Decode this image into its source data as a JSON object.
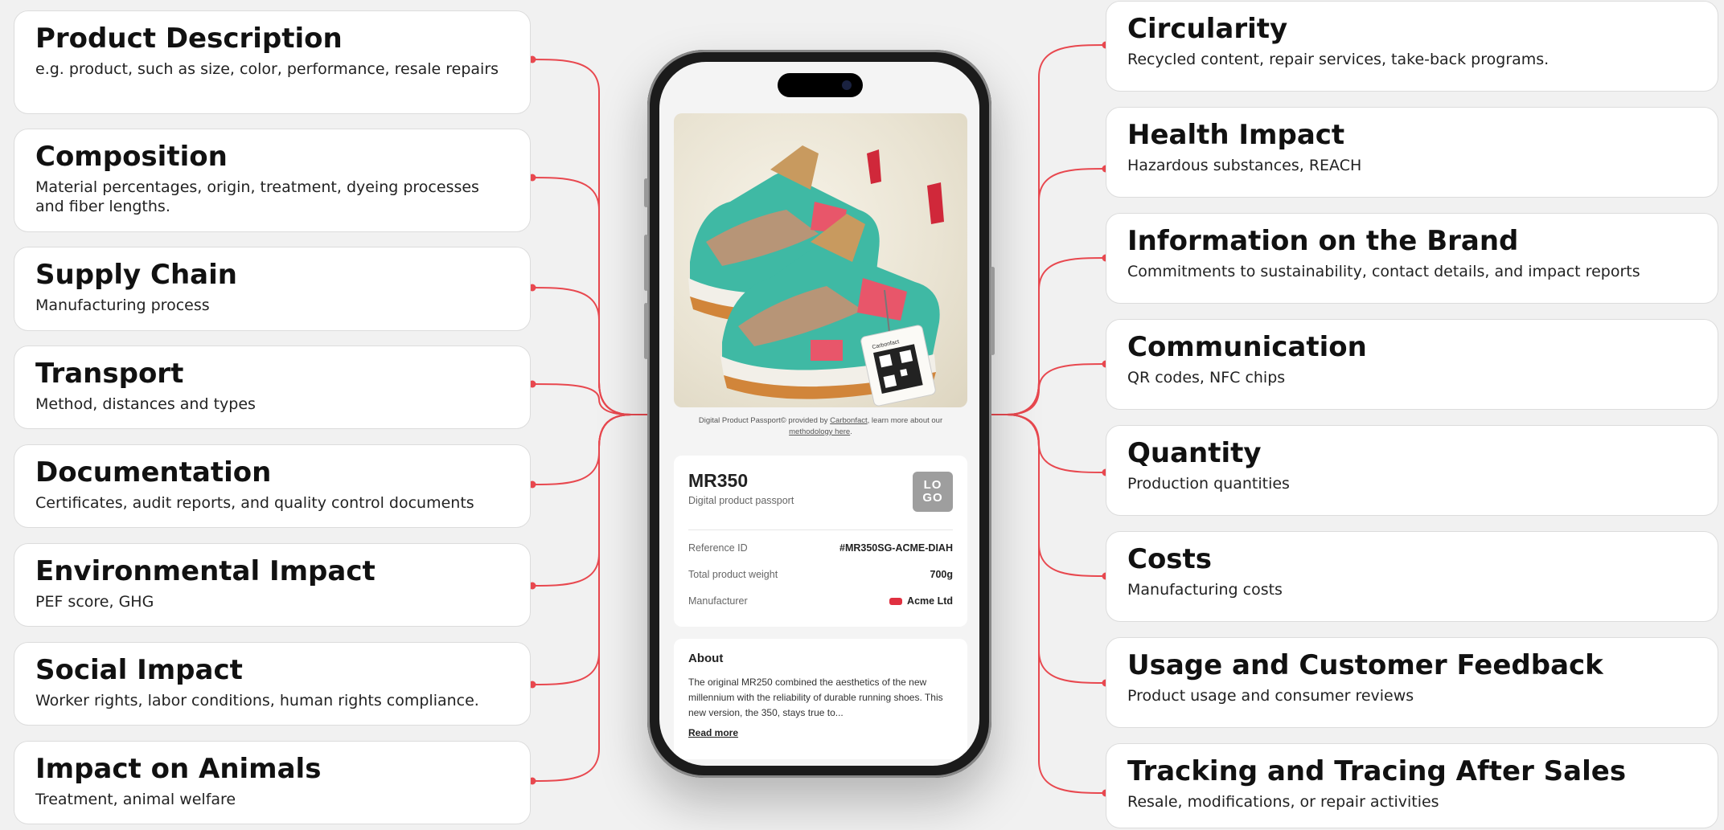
{
  "left_cards": [
    {
      "title": "Product Description",
      "desc": "e.g. product, such as size, color, performance, resale repairs"
    },
    {
      "title": "Composition",
      "desc": "Material percentages, origin, treatment, dyeing processes and fiber lengths."
    },
    {
      "title": "Supply Chain",
      "desc": "Manufacturing process"
    },
    {
      "title": "Transport",
      "desc": "Method, distances and types"
    },
    {
      "title": "Documentation",
      "desc": "Certificates, audit reports, and quality control documents"
    },
    {
      "title": "Environmental Impact",
      "desc": "PEF score, GHG"
    },
    {
      "title": "Social Impact",
      "desc": "Worker rights, labor conditions, human rights compliance."
    },
    {
      "title": "Impact on Animals",
      "desc": "Treatment, animal welfare"
    }
  ],
  "right_cards": [
    {
      "title": "Circularity",
      "desc": "Recycled content, repair services, take-back programs."
    },
    {
      "title": "Health Impact",
      "desc": "Hazardous substances, REACH"
    },
    {
      "title": "Information on the Brand",
      "desc": "Commitments to sustainability, contact details, and impact reports"
    },
    {
      "title": "Communication",
      "desc": "QR codes, NFC chips"
    },
    {
      "title": "Quantity",
      "desc": "Production quantities"
    },
    {
      "title": "Costs",
      "desc": "Manufacturing costs"
    },
    {
      "title": "Usage and Customer Feedback",
      "desc": "Product usage and consumer reviews"
    },
    {
      "title": "Tracking and Tracing After Sales",
      "desc": "Resale, modifications, or repair activities"
    }
  ],
  "colors": {
    "connector": "#e8484f",
    "card_border": "#dcdcdc"
  },
  "phone": {
    "tag_brand": "Carbonfact",
    "caption_prefix": "Digital Product Passport© provided by ",
    "caption_link1": "Carbonfact",
    "caption_mid": ", learn more about our",
    "caption_link2": "methodology here",
    "caption_end": ".",
    "model": "MR350",
    "subtitle": "Digital product passport",
    "logo_text": "LO GO",
    "rows": [
      {
        "label": "Reference ID",
        "value": "#MR350SG-ACME-DIAH"
      },
      {
        "label": "Total product weight",
        "value": "700g"
      },
      {
        "label": "Manufacturer",
        "value": "Acme Ltd"
      }
    ],
    "about_title": "About",
    "about_text": "The original MR250 combined the aesthetics of the new millennium with the reliability of durable running shoes. This new version, the 350, stays true to...",
    "read_more": "Read more"
  }
}
